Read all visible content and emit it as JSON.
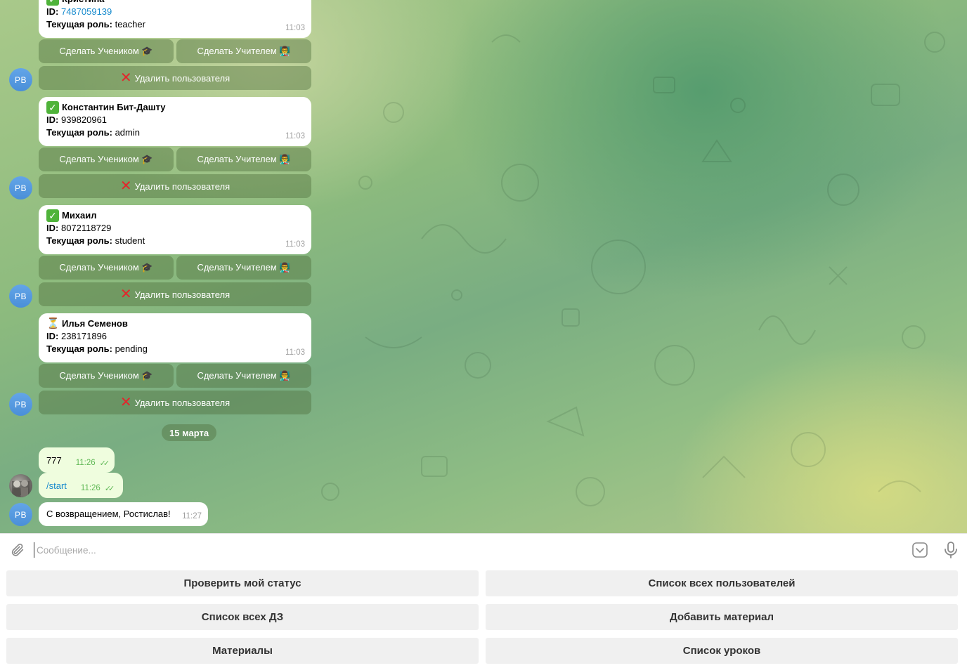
{
  "messages": [
    {
      "name": "Кристина",
      "status_icon": "check-icon",
      "id_label": "ID:",
      "id": "7487059139",
      "id_is_link": true,
      "role_label": "Текущая роль:",
      "role": "teacher",
      "time": "11:03"
    },
    {
      "name": "Константин Бит-Дашту",
      "status_icon": "check-icon",
      "id_label": "ID:",
      "id": "939820961",
      "id_is_link": false,
      "role_label": "Текущая роль:",
      "role": "admin",
      "time": "11:03"
    },
    {
      "name": "Михаил",
      "status_icon": "check-icon",
      "id_label": "ID:",
      "id": "8072118729",
      "id_is_link": false,
      "role_label": "Текущая роль:",
      "role": "student",
      "time": "11:03"
    },
    {
      "name": "Илья Семенов",
      "status_icon": "hourglass-icon",
      "id_label": "ID:",
      "id": "238171896",
      "id_is_link": false,
      "role_label": "Текущая роль:",
      "role": "pending",
      "time": "11:03"
    }
  ],
  "inline_buttons": {
    "make_student": "Сделать Учеником 🎓",
    "make_teacher": "Сделать Учителем 👨‍🏫",
    "delete_user": "Удалить пользователя"
  },
  "bot_avatar_initials": "РВ",
  "date_separator": "15 марта",
  "outgoing": [
    {
      "text": "777",
      "time": "11:26"
    },
    {
      "text": "/start",
      "time": "11:26"
    }
  ],
  "bot_reply": {
    "text": "С возвращением, Ростислав!",
    "time": "11:27"
  },
  "composer": {
    "placeholder": "Сообщение..."
  },
  "reply_keyboard": [
    "Проверить мой статус",
    "Список всех пользователей",
    "Список всех ДЗ",
    "Добавить материал",
    "Материалы",
    "Список уроков"
  ],
  "colors": {
    "inline_button_bg": "rgba(78,110,60,0.42)",
    "link": "#168acd",
    "outgoing_bubble": "#effdde",
    "read_ticks": "#5fb855",
    "avatar": "#5b9ee6"
  }
}
